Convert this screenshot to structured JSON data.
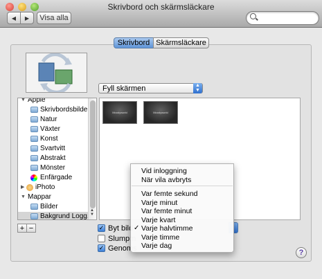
{
  "window": {
    "title": "Skrivbord och skärmsläckare"
  },
  "toolbar": {
    "back_icon": "◀",
    "forward_icon": "▶",
    "show_all_label": "Visa alla",
    "search_placeholder": ""
  },
  "tabs": [
    {
      "label": "Skrivbord",
      "selected": true
    },
    {
      "label": "Skärmsläckare",
      "selected": false
    }
  ],
  "fit_popup": {
    "value": "Fyll skärmen"
  },
  "sidebar": {
    "items": [
      {
        "label": "Apple",
        "kind": "group"
      },
      {
        "label": "Skrivbordsbilder",
        "kind": "folder"
      },
      {
        "label": "Natur",
        "kind": "folder"
      },
      {
        "label": "Växter",
        "kind": "folder"
      },
      {
        "label": "Konst",
        "kind": "folder"
      },
      {
        "label": "Svartvitt",
        "kind": "folder"
      },
      {
        "label": "Abstrakt",
        "kind": "folder"
      },
      {
        "label": "Mönster",
        "kind": "folder"
      },
      {
        "label": "Enfärgade",
        "kind": "colors"
      },
      {
        "label": "iPhoto",
        "kind": "group-collapsed"
      },
      {
        "label": "Mappar",
        "kind": "group"
      },
      {
        "label": "Bilder",
        "kind": "folder"
      },
      {
        "label": "Bakgrund Logg...",
        "kind": "folder",
        "selected": true
      }
    ]
  },
  "thumbnails": [
    {
      "caption": "Moodyworld"
    },
    {
      "caption": "Moodyworld"
    }
  ],
  "list_buttons": {
    "add": "+",
    "remove": "−"
  },
  "options": [
    {
      "label": "Byt bild",
      "checked": true
    },
    {
      "label": "Slumpm",
      "checked": false
    },
    {
      "label": "Genoms",
      "checked": true
    }
  ],
  "interval_menu": {
    "group1": [
      "Vid inloggning",
      "När vila avbryts"
    ],
    "group2": [
      "Var femte sekund",
      "Varje minut",
      "Var femte minut",
      "Varje kvart",
      "Varje halvtimme",
      "Varje timme",
      "Varje dag"
    ],
    "selected": "Varje halvtimme",
    "check_glyph": "✓"
  },
  "help": {
    "label": "?"
  }
}
